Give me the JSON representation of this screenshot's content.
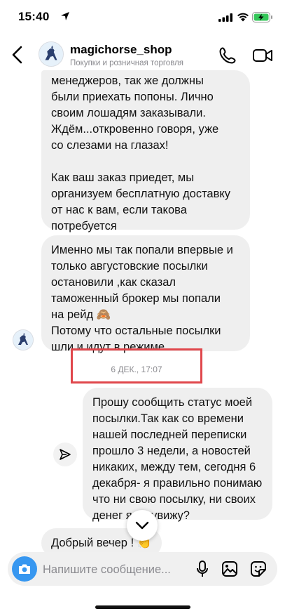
{
  "status_bar": {
    "time": "15:40"
  },
  "header": {
    "name": "magichorse_shop",
    "subtitle": "Покупки и розничная торговля"
  },
  "messages": [
    {
      "text": "менеджеров, так же должны\nбыли приехать попоны. Лично\nсвоим лошадям заказывали.\nЖдём...откровенно говоря, уже\nсо слезами на глазах!\n\nКак ваш заказ приедет, мы\nорганизуем бесплатную доставку\nот нас к вам, если такова\nпотребуется"
    },
    {
      "text": "Именно мы так попали впервые и\nтолько августовские посылки\nостановили ,как сказал\nтаможенный брокер мы попали\nна рейд 🙈\nПотому что остальные посылки\nшли и идут в режиме"
    }
  ],
  "timestamp": "6 ДЕК., 17:07",
  "outgoing": {
    "text": "Прошу сообщить статус моей\nпосылки.Так как со времени\nнашей последней переписки\nпрошло 3 недели, а новостей\nникаких, между тем, сегодня 6\nдекабря- я правильно понимаю\nчто ни свою посылку, ни своих\nденег я не увижу?"
  },
  "last_message": {
    "text": "Добрый вечер ! 👏"
  },
  "composer": {
    "placeholder": "Напишите сообщение..."
  },
  "colors": {
    "accent": "#3797f0",
    "bubble": "#efefef",
    "highlight_box": "#e0474c"
  }
}
